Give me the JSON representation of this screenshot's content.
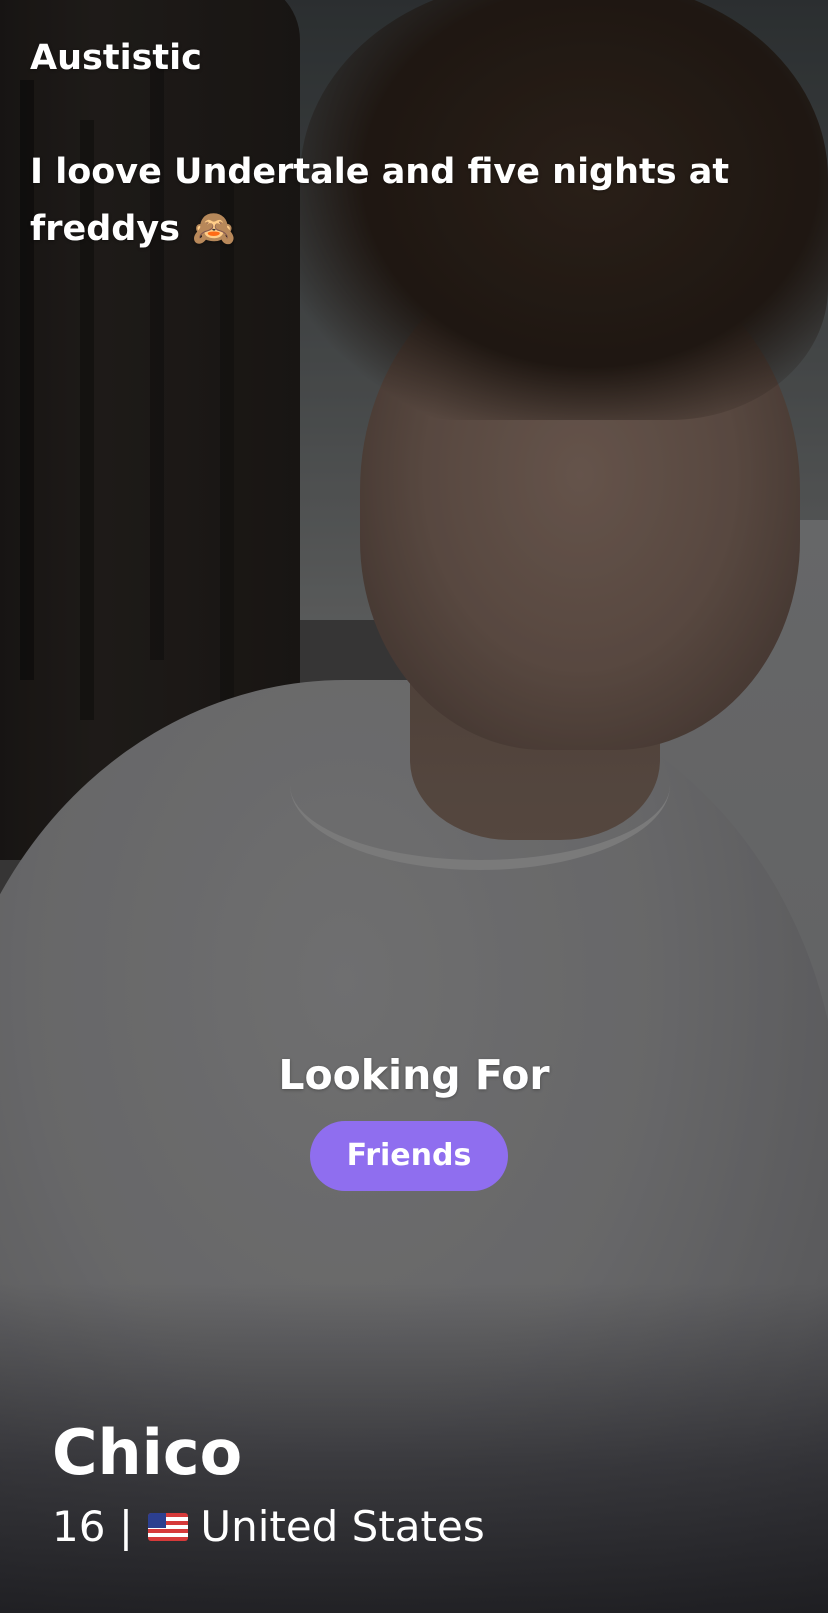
{
  "profile": {
    "bio": "Austistic\n\nI loove Undertale and five nights at freddys 🙈",
    "looking_for": {
      "title": "Looking For",
      "tags": [
        "Friends"
      ]
    },
    "name": "Chico",
    "age": "16",
    "separator": "|",
    "country": "United States",
    "country_flag_icon": "us-flag-icon"
  },
  "colors": {
    "tag_background": "#8f6eef",
    "text": "#ffffff"
  }
}
